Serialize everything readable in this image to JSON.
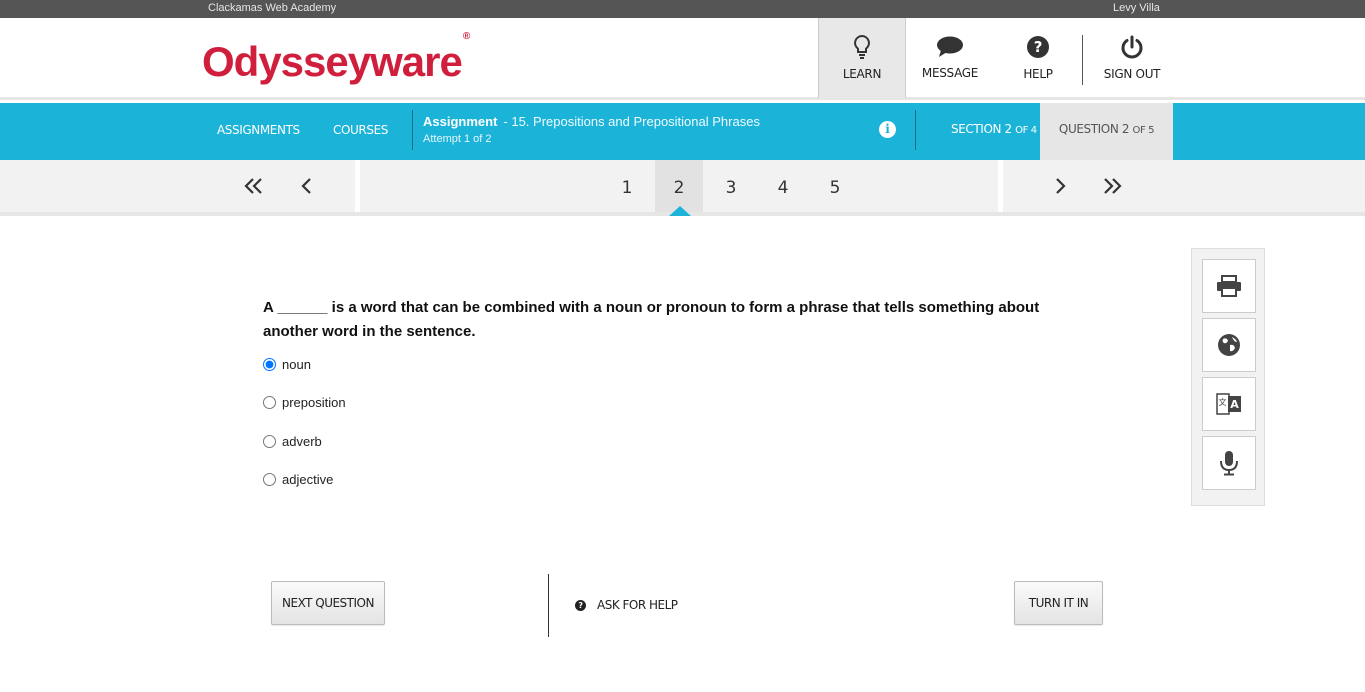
{
  "topbar": {
    "school": "Clackamas Web Academy",
    "user": "Levy Villa"
  },
  "header": {
    "logo": "Odysseyware",
    "logo_mark": "®",
    "nav": [
      {
        "label": "LEARN",
        "icon": "lightbulb-icon"
      },
      {
        "label": "MESSAGE",
        "icon": "chat-bubble-icon"
      },
      {
        "label": "HELP",
        "icon": "question-circle-icon"
      },
      {
        "label": "SIGN OUT",
        "icon": "power-icon"
      }
    ]
  },
  "bluebar": {
    "assignments": "ASSIGNMENTS",
    "courses": "COURSES",
    "assignment_label": "Assignment",
    "assignment_name": "- 15. Prepositions and Prepositional Phrases",
    "attempt": "Attempt 1 of 2",
    "info": "i",
    "section_prefix": "SECTION 2",
    "section_suffix": "OF 4",
    "question_prefix": "QUESTION 2",
    "question_suffix": "OF 5"
  },
  "pager": {
    "pages": [
      "1",
      "2",
      "3",
      "4",
      "5"
    ],
    "current": "2"
  },
  "question": {
    "text": "A ______ is a word that can be combined with a noun or pronoun to form a phrase that tells something about another word in the sentence.",
    "options": [
      "noun",
      "preposition",
      "adverb",
      "adjective"
    ],
    "selected": "noun"
  },
  "tools": [
    "print-icon",
    "globe-icon",
    "translate-icon",
    "microphone-icon"
  ],
  "actions": {
    "next": "NEXT QUESTION",
    "ask": "ASK FOR HELP",
    "ask_icon": "?",
    "turn_in": "TURN IT IN"
  },
  "colors": {
    "brand_red": "#d01f3c",
    "accent_blue": "#1cb3d9",
    "topbar": "#555555"
  }
}
